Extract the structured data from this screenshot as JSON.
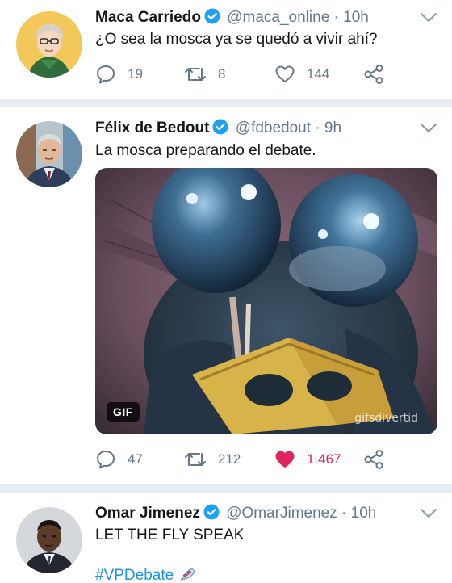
{
  "tweets": [
    {
      "name": "Maca Carriedo",
      "handle": "@maca_online",
      "dot": "·",
      "time": "10h",
      "text": "¿O sea la mosca ya se quedó a vivir ahí?",
      "replies": "19",
      "retweets": "8",
      "likes": "144",
      "liked": false
    },
    {
      "name": "Félix de Bedout",
      "handle": "@fdbedout",
      "dot": "·",
      "time": "9h",
      "text": "La mosca preparando el debate.",
      "media": {
        "badge": "GIF",
        "watermark": "gifsdivertid"
      },
      "replies": "47",
      "retweets": "212",
      "likes": "1.467",
      "liked": true
    },
    {
      "name": "Omar Jimenez",
      "handle": "@OmarJimenez",
      "dot": "·",
      "time": "10h",
      "text": "LET THE FLY SPEAK",
      "hashtag": "#VPDebate"
    }
  ],
  "icons": {
    "verified": "verified-badge-icon",
    "menu": "chevron-down-icon",
    "reply": "reply-icon",
    "retweet": "retweet-icon",
    "like": "heart-icon",
    "share": "share-icon"
  },
  "colors": {
    "verified": "#1da1f2",
    "liked": "#e0245e",
    "muted": "#657786",
    "hashtag": "#1b95e0",
    "divider": "#e6ecf0"
  }
}
